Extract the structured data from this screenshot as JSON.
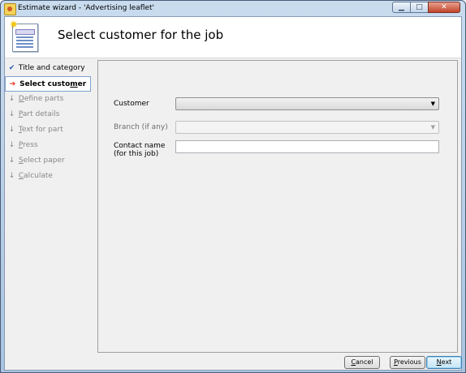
{
  "window": {
    "title": "Estimate wizard - 'Advertising leaflet'",
    "minimize_glyph": "▁",
    "maximize_glyph": "□",
    "close_glyph": "✕"
  },
  "header": {
    "title": "Select customer for the job",
    "icon": "document-form-icon"
  },
  "steps": [
    {
      "pre": "Title and category",
      "key": "",
      "post": "",
      "marker": "✔",
      "state": "done"
    },
    {
      "pre": "Select custo",
      "key": "m",
      "post": "er",
      "marker": "➔",
      "state": "current"
    },
    {
      "pre": "",
      "key": "D",
      "post": "efine parts",
      "marker": "↓",
      "state": "pending"
    },
    {
      "pre": "",
      "key": "P",
      "post": "art details",
      "marker": "↓",
      "state": "pending"
    },
    {
      "pre": "",
      "key": "T",
      "post": "ext for part",
      "marker": "↓",
      "state": "pending"
    },
    {
      "pre": "",
      "key": "P",
      "post": "ress",
      "marker": "↓",
      "state": "pending"
    },
    {
      "pre": "",
      "key": "S",
      "post": "elect paper",
      "marker": "↓",
      "state": "pending"
    },
    {
      "pre": "",
      "key": "C",
      "post": "alculate",
      "marker": "↓",
      "state": "pending"
    }
  ],
  "form": {
    "customer_label": "Customer",
    "customer_value": "",
    "branch_label": "Branch (if any)",
    "branch_value": "",
    "contact_label_line1": "Contact name",
    "contact_label_line2": "(for this job)",
    "contact_value": ""
  },
  "buttons": {
    "cancel": {
      "key": "C",
      "rest": "ancel"
    },
    "previous": {
      "key": "P",
      "rest": "revious"
    },
    "next": {
      "key": "N",
      "rest": "ext"
    }
  },
  "colors": {
    "current_step_marker": "#e03020",
    "done_step_marker": "#2a5db0",
    "default_button_border": "#3c7fb1"
  }
}
